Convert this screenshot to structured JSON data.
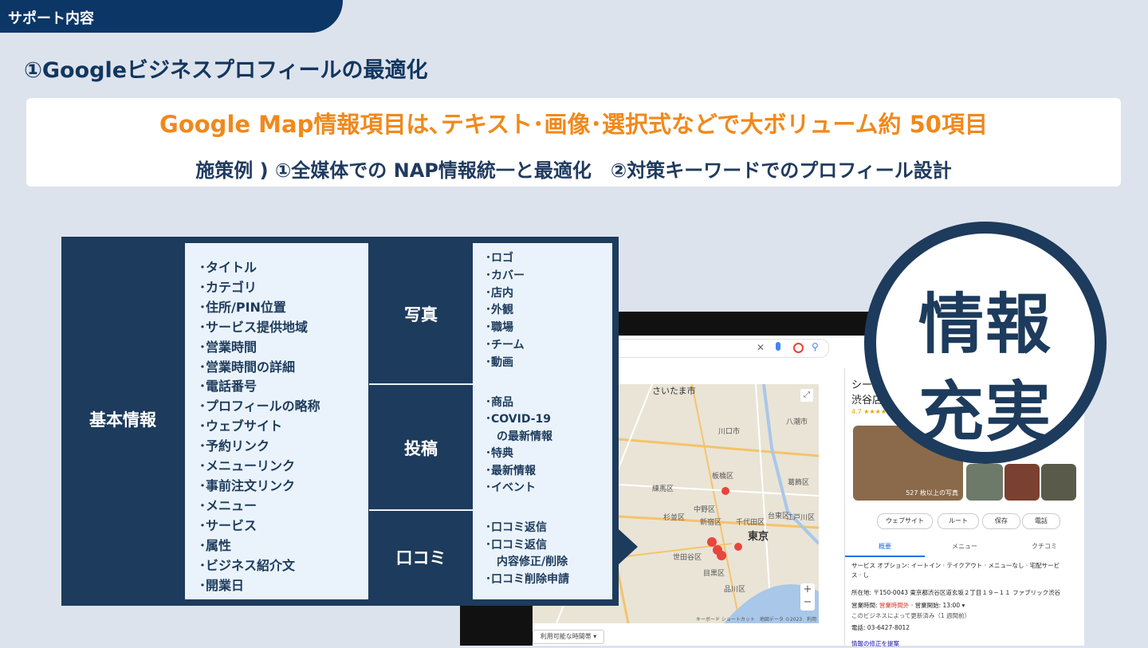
{
  "header": {
    "tab_label": "サポート内容",
    "title": "①Googleビジネスプロフィールの最適化"
  },
  "banner": {
    "line1": "Google Map情報項目は､テキスト･画像･選択式などで大ボリューム約 50項目",
    "line2": "施策例 ) ①全媒体での NAP情報統一と最適化　②対策キーワードでのプロフィール設計"
  },
  "table": {
    "basic": {
      "label": "基本情報",
      "items": [
        "･タイトル",
        "･カテゴリ",
        "･住所/PIN位置",
        "･サービス提供地域",
        "･営業時間",
        "･営業時間の詳細",
        "･電話番号",
        "･プロフィールの略称",
        "･ウェブサイト",
        "･予約リンク",
        "･メニューリンク",
        "･事前注文リンク",
        "･メニュー",
        "･サービス",
        "･属性",
        "･ビジネス紹介文",
        "･開業日"
      ]
    },
    "photo": {
      "label": "写真",
      "items": [
        "･ロゴ",
        "･カバー",
        "･店内",
        "･外観",
        "･職場",
        "･チーム",
        "･動画"
      ]
    },
    "post": {
      "label": "投稿",
      "items": [
        "･商品",
        "･COVID-19",
        "　の最新情報",
        "･特典",
        "･最新情報",
        "･イベント"
      ]
    },
    "review": {
      "label": "口コミ",
      "items": [
        "･口コミ返信",
        "･口コミ返信",
        "　内容修正/削除",
        "･口コミ削除申請"
      ]
    }
  },
  "badge": {
    "line1": "情報",
    "line2": "充実"
  },
  "screenshot": {
    "map_labels": [
      "さいたま市",
      "川口市",
      "板橋区",
      "練馬区",
      "中野区",
      "杉並区",
      "新宿区",
      "千代田区",
      "台東区",
      "東京",
      "世田谷区",
      "目黒区",
      "品川区",
      "江戸川区",
      "葛飾区",
      "八潮市"
    ],
    "sidebar": {
      "name": "シー",
      "name2": "渋谷店",
      "rating": "4.7 ★★★★★",
      "photo_caption": "527 枚以上の写真",
      "buttons": [
        "ウェブサイト",
        "ルート",
        "保存",
        "電話"
      ],
      "tabs": [
        "概要",
        "メニュー",
        "クチコミ"
      ],
      "service": "サービス オプション: イートイン · テイクアウト · メニューなし · 宅配サービス · し",
      "address": "所在地: 〒150-0043 東京都渋谷区道玄坂２丁目１９−１１ ファブリック渋谷",
      "hours_label": "営業時間:",
      "hours_status": "営業時間外",
      "hours_next": "· 営業開始: 13:00 ▾",
      "hours_note": "このビジネスによって更新済み（1 週間前）",
      "phone": "電話: 03-6427-8012",
      "suggest": "情報の修正を提案"
    },
    "map_footer": "キーボード ショートカット　地図データ ©2023　利用規約",
    "time_filter": "利用可能な時間帯 ▾"
  },
  "colors": {
    "navy": "#1d3b5c",
    "orange": "#f0891c",
    "background": "#dde3ed"
  }
}
